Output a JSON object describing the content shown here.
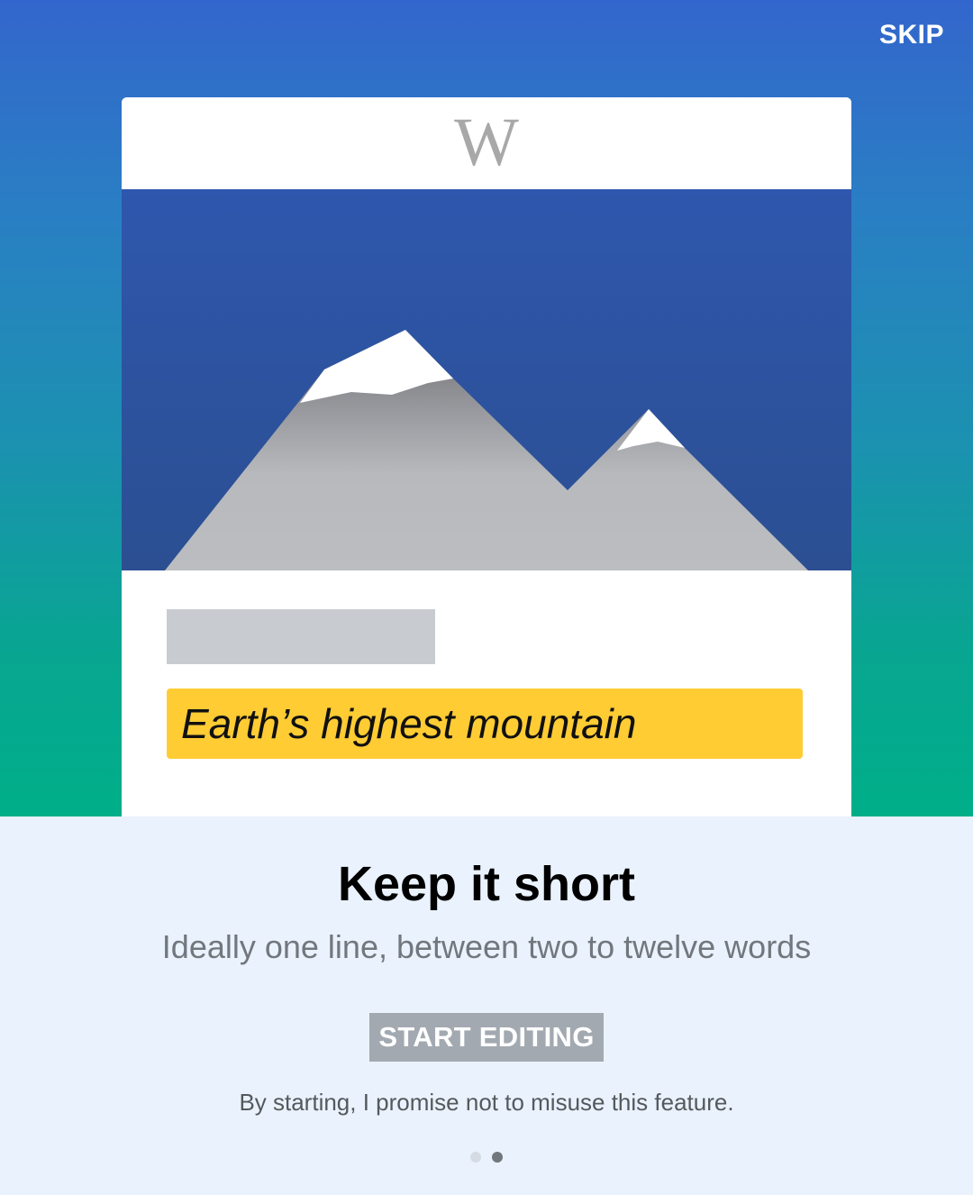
{
  "header": {
    "skip_label": "SKIP"
  },
  "card": {
    "logo_text": "W",
    "highlight_text": "Earth’s highest mountain"
  },
  "onboarding": {
    "title": "Keep it short",
    "subtitle": "Ideally one line, between two to twelve words",
    "start_label": "START EDITING",
    "disclaimer": "By starting, I promise not to misuse this feature.",
    "page_indicator": {
      "current": 2,
      "total": 2
    }
  },
  "colors": {
    "gradient_top": "#3366cc",
    "gradient_bottom": "#00af89",
    "highlight": "#ffcc33",
    "button_disabled": "#a2a9b1",
    "sky": "#2d56a8"
  }
}
